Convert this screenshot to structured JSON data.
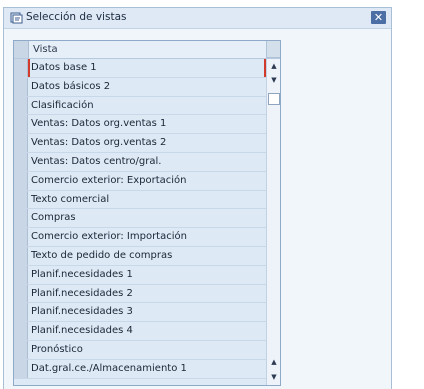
{
  "dialog": {
    "title": "Selección de vistas",
    "close_label": "✕"
  },
  "table": {
    "header": "Vista",
    "rows": [
      "Datos base 1",
      "Datos básicos 2",
      "Clasificación",
      "Ventas: Datos org.ventas 1",
      "Ventas: Datos org.ventas 2",
      "Ventas: Datos centro/gral.",
      "Comercio exterior: Exportación",
      "Texto comercial",
      "Compras",
      "Comercio exterior: Importación",
      "Texto de pedido de compras",
      "Planif.necesidades 1",
      "Planif.necesidades 2",
      "Planif.necesidades 3",
      "Planif.necesidades 4",
      "Pronóstico",
      "Dat.gral.ce./Almacenamiento 1"
    ],
    "focused_row": 0
  },
  "scrollbar": {
    "up_arrow": "▲",
    "down_arrow": "▼"
  },
  "colors": {
    "title_bar": "#dfe9f5",
    "table_bg": "#dde9f5",
    "focus_marker": "#d23b2b",
    "close_button": "#4b6fa5"
  },
  "icons": {
    "title": "view-selection-icon"
  }
}
